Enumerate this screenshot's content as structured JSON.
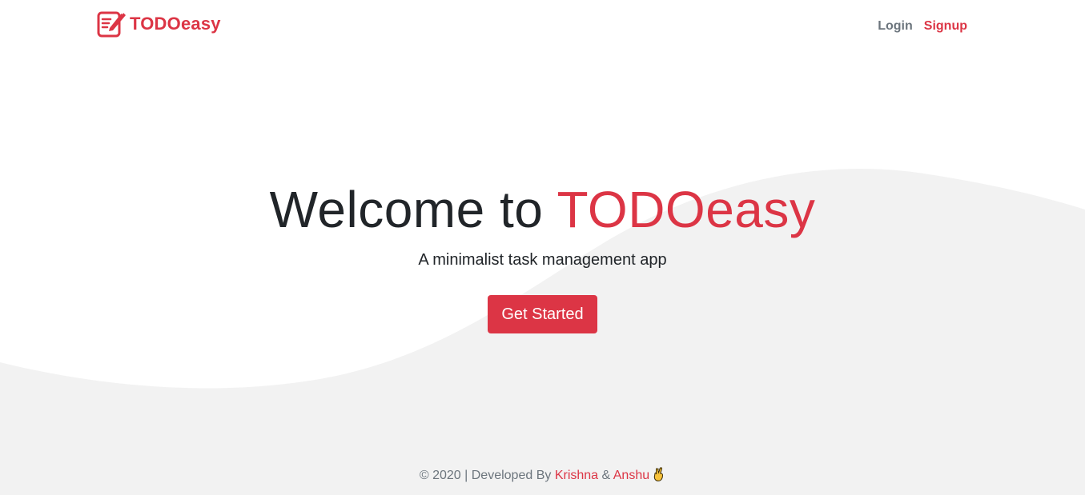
{
  "brand": {
    "name": "TODOeasy",
    "icon": "notepad-pencil-icon",
    "color": "#dc3545"
  },
  "nav": {
    "login_label": "Login",
    "signup_label": "Signup"
  },
  "hero": {
    "title_prefix": "Welcome to ",
    "title_accent": "TODOeasy",
    "subtitle": "A minimalist task management app",
    "cta_label": "Get Started"
  },
  "footer": {
    "prefix": "© 2020 | Developed By ",
    "author_one": "Krishna",
    "separator": " & ",
    "author_two": "Anshu",
    "emoji": "crossed-fingers-icon"
  },
  "colors": {
    "accent": "#dc3545",
    "text_dark": "#212529",
    "text_muted": "#6c757d",
    "wave_gray": "#f2f2f2"
  }
}
